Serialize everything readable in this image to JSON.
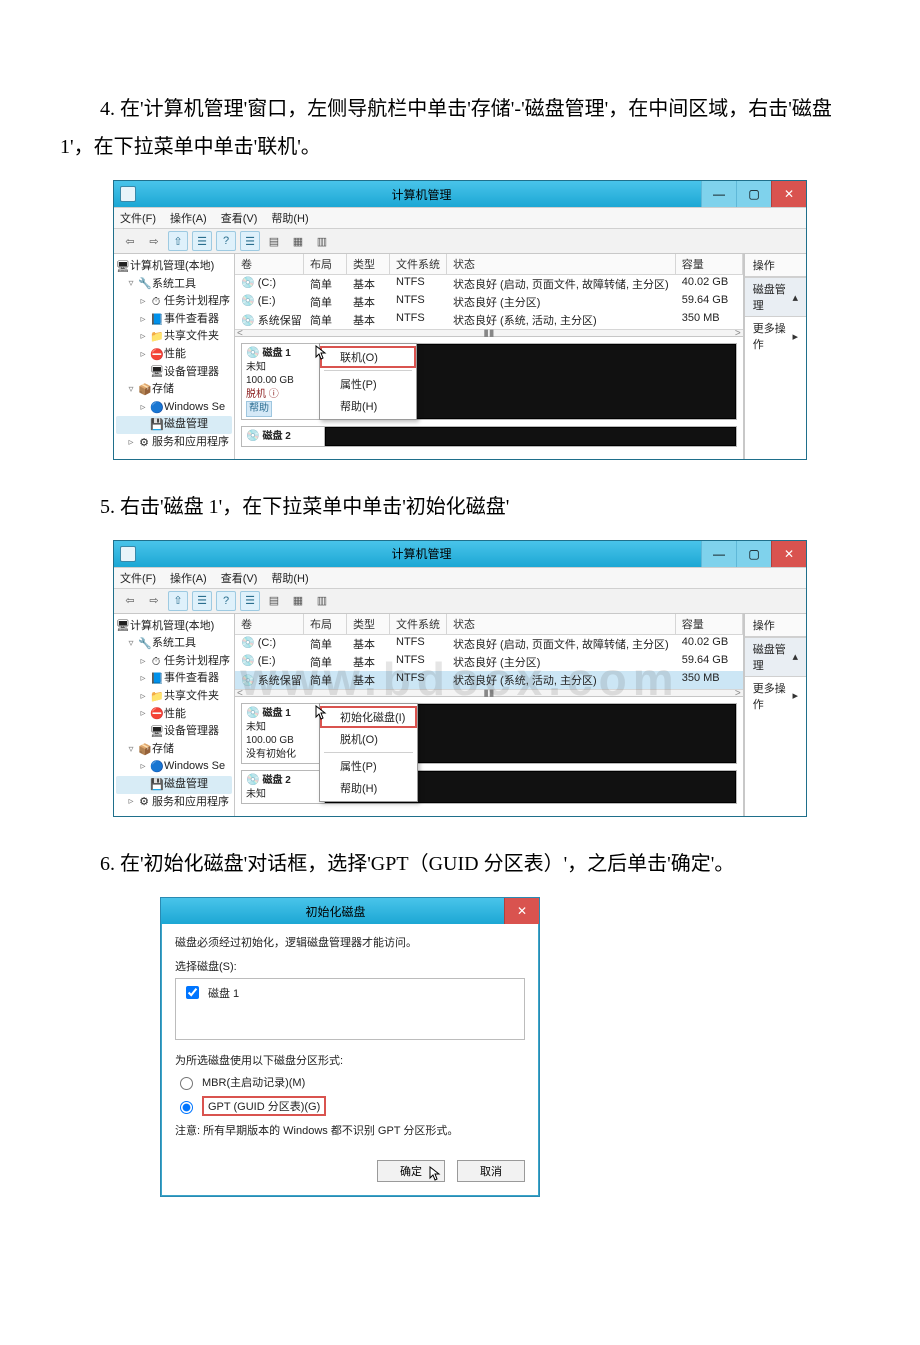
{
  "steps": {
    "s4": "4. 在'计算机管理'窗口，左侧导航栏中单击'存储'-'磁盘管理'，在中间区域，右击'磁盘 1'，在下拉菜单中单击'联机'。",
    "s5": "5. 右击'磁盘 1'，在下拉菜单中单击'初始化磁盘'",
    "s6": "6. 在'初始化磁盘'对话框，选择'GPT（GUID 分区表）'，之后单击'确定'。"
  },
  "cmwin": {
    "title": "计算机管理",
    "menus": [
      "文件(F)",
      "操作(A)",
      "查看(V)",
      "帮助(H)"
    ],
    "nav_root": "计算机管理(本地)",
    "nav": [
      {
        "label": "系统工具",
        "level": 2,
        "tw": "▿"
      },
      {
        "label": "任务计划程序",
        "level": 3,
        "tw": "▹",
        "icon": "⏱"
      },
      {
        "label": "事件查看器",
        "level": 3,
        "tw": "▹",
        "icon": "📘"
      },
      {
        "label": "共享文件夹",
        "level": 3,
        "tw": "▹",
        "icon": "📁"
      },
      {
        "label": "性能",
        "level": 3,
        "tw": "▹",
        "icon": "⛔"
      },
      {
        "label": "设备管理器",
        "level": 3,
        "tw": "",
        "icon": "🖥"
      },
      {
        "label": "存储",
        "level": 2,
        "tw": "▿",
        "icon": "📦"
      },
      {
        "label": "Windows Se",
        "level": 3,
        "tw": "▹",
        "icon": "🔵"
      },
      {
        "label": "磁盘管理",
        "level": 3,
        "tw": "",
        "icon": "💾",
        "sel": true
      },
      {
        "label": "服务和应用程序",
        "level": 2,
        "tw": "▹",
        "icon": "⚙"
      }
    ],
    "vol_headers": [
      "卷",
      "布局",
      "类型",
      "文件系统",
      "状态",
      "容量"
    ],
    "volumes": [
      {
        "name": "(C:)",
        "layout": "简单",
        "type": "基本",
        "fs": "NTFS",
        "status": "状态良好 (启动, 页面文件, 故障转储, 主分区)",
        "cap": "40.02 GB"
      },
      {
        "name": "(E:)",
        "layout": "简单",
        "type": "基本",
        "fs": "NTFS",
        "status": "状态良好 (主分区)",
        "cap": "59.64 GB"
      },
      {
        "name": "系统保留",
        "layout": "简单",
        "type": "基本",
        "fs": "NTFS",
        "status": "状态良好 (系统, 活动, 主分区)",
        "cap": "350 MB"
      }
    ],
    "actions_header": "操作",
    "actions_tab": "磁盘管理",
    "actions_more": "更多操作",
    "disk1": {
      "title": "磁盘 1",
      "state_a": "未知",
      "size": "100.00 GB",
      "offline": "脱机 ⓘ",
      "help": "帮助",
      "uninit": "没有初始化"
    },
    "disk2": {
      "title": "磁盘 2",
      "state": "未知"
    },
    "ctx_online": [
      "联机(O)",
      "属性(P)",
      "帮助(H)"
    ],
    "ctx_init": [
      "初始化磁盘(I)",
      "脱机(O)",
      "属性(P)",
      "帮助(H)"
    ]
  },
  "dlg": {
    "title": "初始化磁盘",
    "msg": "磁盘必须经过初始化，逻辑磁盘管理器才能访问。",
    "select_label": "选择磁盘(S):",
    "disk_item": "磁盘 1",
    "style_label": "为所选磁盘使用以下磁盘分区形式:",
    "mbr": "MBR(主启动记录)(M)",
    "gpt": "GPT (GUID 分区表)(G)",
    "note": "注意: 所有早期版本的 Windows 都不识别 GPT 分区形式。",
    "ok": "确定",
    "cancel": "取消"
  },
  "watermark": "www.bdocx.com"
}
